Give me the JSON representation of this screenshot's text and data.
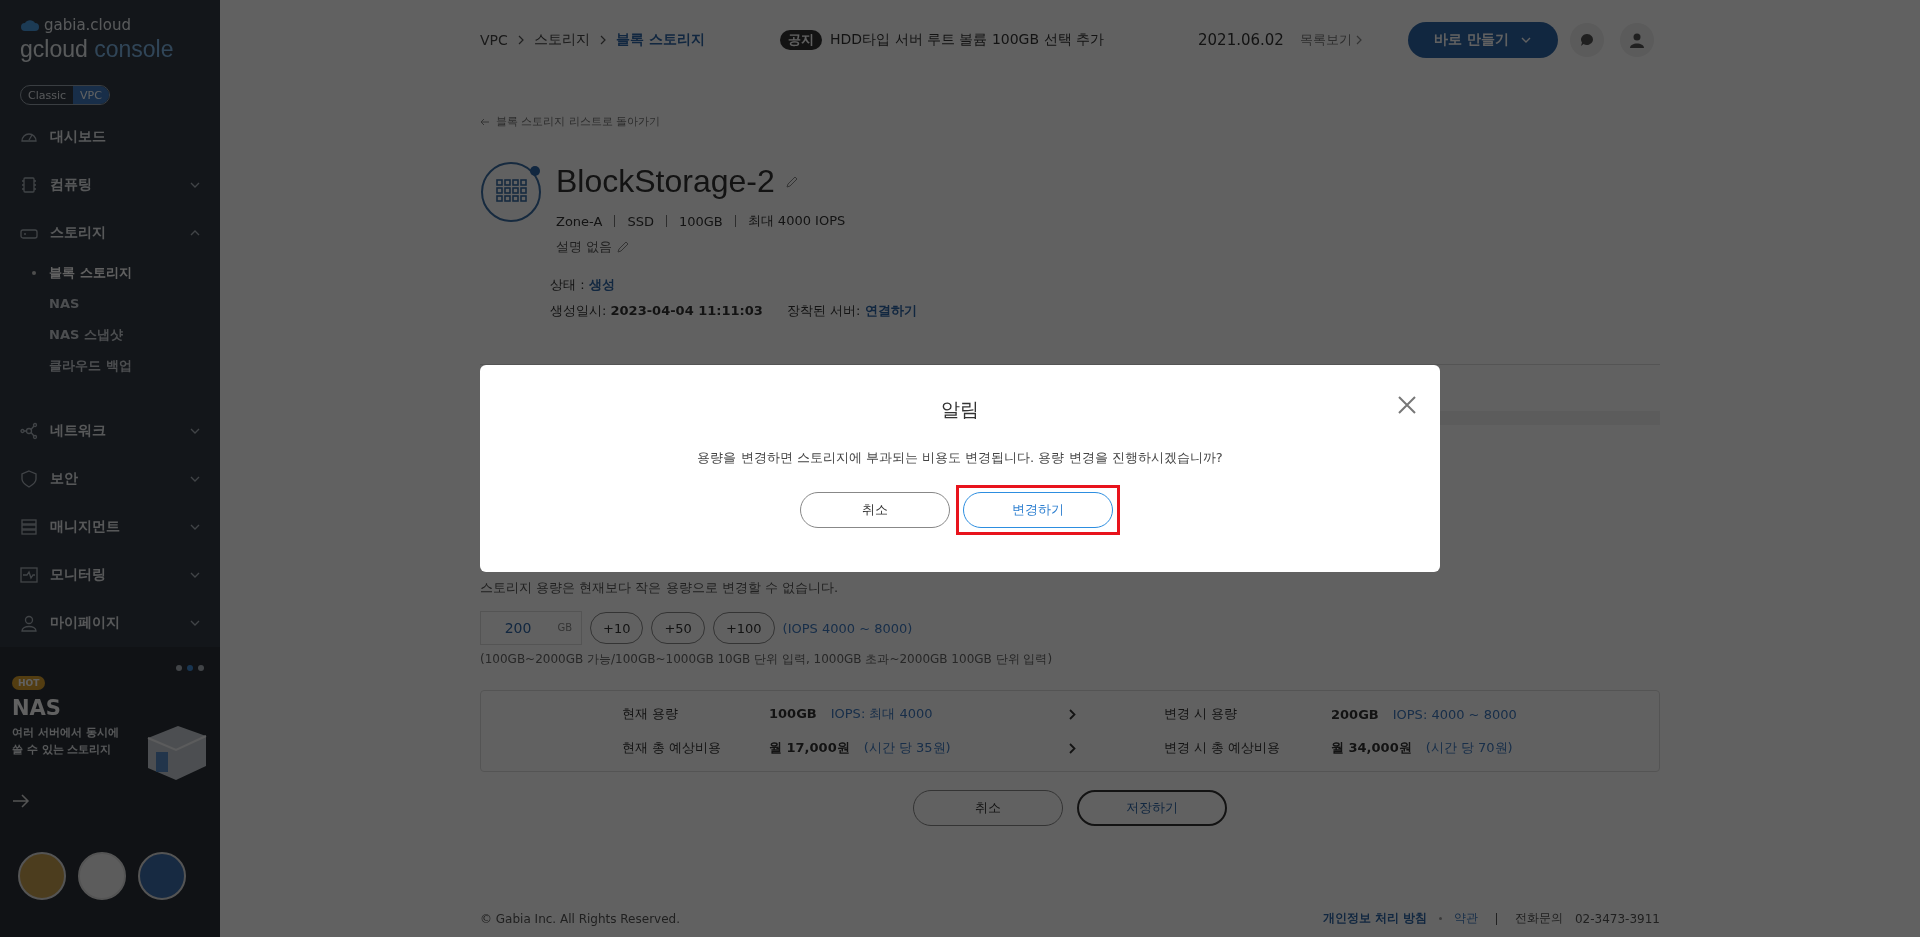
{
  "sidebar": {
    "brand": "gabia.cloud",
    "product": {
      "main": "gcloud",
      "sub": "console"
    },
    "mode_toggle": [
      {
        "label": "Classic",
        "selected": false
      },
      {
        "label": "VPC",
        "selected": true
      }
    ],
    "menu": [
      {
        "label": "대시보드",
        "kind": "link"
      },
      {
        "label": "컴퓨팅",
        "kind": "group",
        "expanded": false
      },
      {
        "label": "스토리지",
        "kind": "group",
        "expanded": true,
        "children": [
          {
            "label": "블록 스토리지",
            "selected": true
          },
          {
            "label": "NAS",
            "selected": false
          },
          {
            "label": "NAS 스냅샷",
            "selected": false
          },
          {
            "label": "클라우드 백업",
            "selected": false
          }
        ]
      },
      {
        "label": "네트워크",
        "kind": "group",
        "expanded": false
      },
      {
        "label": "보안",
        "kind": "group",
        "expanded": false
      },
      {
        "label": "매니지먼트",
        "kind": "group",
        "expanded": false
      },
      {
        "label": "모니터링",
        "kind": "group",
        "expanded": false
      },
      {
        "label": "마이페이지",
        "kind": "group",
        "expanded": false
      }
    ],
    "promo": {
      "dots": [
        {
          "selected": false
        },
        {
          "selected": true
        },
        {
          "selected": false
        }
      ],
      "badge": "HOT",
      "title": "NAS",
      "lines": [
        "여러 서버에서 동시에",
        "쓸 수 있는 스토리지"
      ]
    }
  },
  "header": {
    "breadcrumb": [
      {
        "label": "VPC",
        "current": false
      },
      {
        "label": "스토리지",
        "current": false
      },
      {
        "label": "블록 스토리지",
        "current": true
      }
    ],
    "notice": {
      "tag": "공지",
      "text": "HDD타입 서버 루트 볼륨 100GB 선택 추가",
      "date": "2021.06.02",
      "more": "목록보기"
    },
    "create_button": "바로 만들기"
  },
  "detail": {
    "back_link": "블록 스토리지 리스트로 돌아가기",
    "name": "BlockStorage-2",
    "specs": [
      "Zone-A",
      "SSD",
      "100GB",
      "최대 4000 IOPS"
    ],
    "description": "설명 없음",
    "status": {
      "label": "상태 :",
      "value": "생성"
    },
    "created": {
      "label": "생성일시:",
      "value": "2023-04-04 11:11:03"
    },
    "server": {
      "label": "장착된 서버:",
      "value": "연결하기"
    }
  },
  "resize": {
    "note": "스토리지 용량은 현재보다 작은 용량으로 변경할 수 없습니다.",
    "input": {
      "value": "200",
      "unit": "GB"
    },
    "increments": [
      "+10",
      "+50",
      "+100"
    ],
    "iops": "(IOPS 4000 ~ 8000)",
    "hint": "(100GB~2000GB 가능/100GB~1000GB 10GB 단위 입력, 1000GB 초과~2000GB 100GB 단위 입력)",
    "comparison": [
      {
        "current_label": "현재 용량",
        "current_value": "100GB",
        "current_extra": "IOPS: 최대 4000",
        "new_label": "변경 시 용량",
        "new_value": "200GB",
        "new_extra": "IOPS: 4000 ~ 8000"
      },
      {
        "current_label": "현재 총 예상비용",
        "current_value": "월 17,000원",
        "current_extra": "(시간 당 35원)",
        "new_label": "변경 시 총 예상비용",
        "new_value": "월 34,000원",
        "new_extra": "(시간 당 70원)"
      }
    ],
    "cancel": "취소",
    "save": "저장하기"
  },
  "footer": {
    "copyright": "© Gabia Inc. All Rights Reserved.",
    "links": [
      "개인정보 처리 방침",
      "약관"
    ],
    "phone_label": "전화문의",
    "phone": "02-3473-3911"
  },
  "modal": {
    "title": "알림",
    "message": "용량을 변경하면 스토리지에 부과되는 비용도 변경됩니다. 용량 변경을 진행하시겠습니까?",
    "cancel": "취소",
    "confirm": "변경하기",
    "confirm_highlighted": true
  }
}
